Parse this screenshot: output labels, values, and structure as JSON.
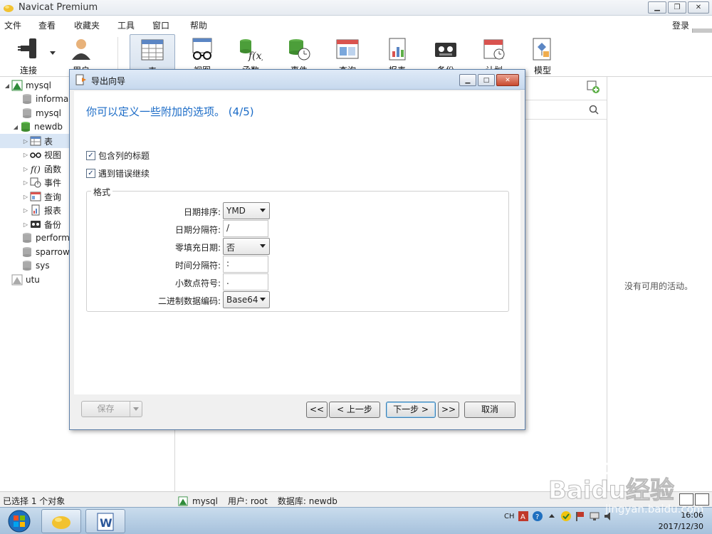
{
  "window": {
    "title": "Navicat Premium"
  },
  "menu": [
    "文件",
    "查看",
    "收藏夹",
    "工具",
    "窗口",
    "帮助"
  ],
  "login_label": "登录",
  "toolbar": {
    "connect": "连接",
    "user": "用户",
    "table": "表",
    "view": "视图",
    "function": "函数",
    "event": "事件",
    "query": "查询",
    "report": "报表",
    "backup": "备份",
    "schedule": "计划",
    "model": "模型"
  },
  "tree": {
    "mysql": "mysql",
    "information": "informa",
    "mysql_db": "mysql",
    "newdb": "newdb",
    "table": "表",
    "view": "视图",
    "function": "函数",
    "event": "事件",
    "query": "查询",
    "report": "报表",
    "backup": "备份",
    "performance": "perform",
    "sparrow": "sparrow",
    "sys": "sys",
    "utu": "utu"
  },
  "right_panel": {
    "no_activity": "没有可用的活动。"
  },
  "status": {
    "selected": "已选择 1 个对象",
    "connection": "mysql",
    "user": "用户: root",
    "database": "数据库: newdb"
  },
  "dialog": {
    "title": "导出向导",
    "heading": "你可以定义一些附加的选项。 (4/5)",
    "include_header": "包含列的标题",
    "continue_on_error": "遇到错误继续",
    "format_legend": "格式",
    "date_order_label": "日期排序:",
    "date_order_value": "YMD",
    "date_delim_label": "日期分隔符:",
    "date_delim_value": "/",
    "zero_pad_label": "零填充日期:",
    "zero_pad_value": "否",
    "time_delim_label": "时间分隔符:",
    "time_delim_value": ":",
    "decimal_label": "小数点符号:",
    "decimal_value": ".",
    "binary_label": "二进制数据编码:",
    "binary_value": "Base64",
    "save_btn": "保存",
    "first_btn": "<<",
    "prev_btn": "< 上一步",
    "next_btn": "下一步 >",
    "last_btn": ">>",
    "cancel_btn": "取消"
  },
  "taskbar": {
    "lang": "CH",
    "time": "16:06",
    "date": "2017/12/30"
  },
  "watermark": "jingyan.baidu.com"
}
